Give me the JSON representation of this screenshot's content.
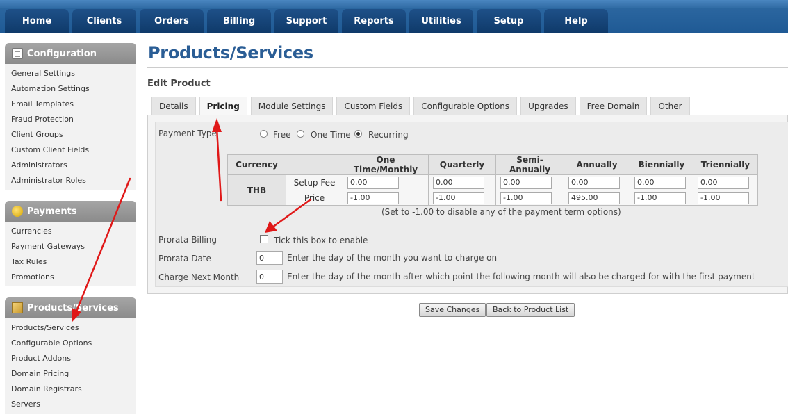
{
  "nav": {
    "tabs": [
      "Home",
      "Clients",
      "Orders",
      "Billing",
      "Support",
      "Reports",
      "Utilities",
      "Setup",
      "Help"
    ]
  },
  "sidebar": {
    "configuration": {
      "title": "Configuration",
      "items": [
        "General Settings",
        "Automation Settings",
        "Email Templates",
        "Fraud Protection",
        "Client Groups",
        "Custom Client Fields",
        "Administrators",
        "Administrator Roles"
      ]
    },
    "payments": {
      "title": "Payments",
      "items": [
        "Currencies",
        "Payment Gateways",
        "Tax Rules",
        "Promotions"
      ]
    },
    "products": {
      "title": "Products/Services",
      "items": [
        "Products/Services",
        "Configurable Options",
        "Product Addons",
        "Domain Pricing",
        "Domain Registrars",
        "Servers"
      ]
    }
  },
  "page": {
    "title": "Products/Services",
    "subtitle": "Edit Product"
  },
  "tabs": [
    "Details",
    "Pricing",
    "Module Settings",
    "Custom Fields",
    "Configurable Options",
    "Upgrades",
    "Free Domain",
    "Other"
  ],
  "active_tab": "Pricing",
  "payment_type": {
    "label": "Payment Type",
    "options": [
      "Free",
      "One Time",
      "Recurring"
    ],
    "selected": "Recurring"
  },
  "pricing_table": {
    "currency_header": "Currency",
    "currency": "THB",
    "columns": [
      "One Time/Monthly",
      "Quarterly",
      "Semi-Annually",
      "Annually",
      "Biennially",
      "Triennially"
    ],
    "rows": [
      {
        "label": "Setup Fee",
        "values": [
          "0.00",
          "0.00",
          "0.00",
          "0.00",
          "0.00",
          "0.00"
        ]
      },
      {
        "label": "Price",
        "values": [
          "-1.00",
          "-1.00",
          "-1.00",
          "495.00",
          "-1.00",
          "-1.00"
        ]
      }
    ],
    "note": "(Set to -1.00 to disable any of the payment term options)"
  },
  "prorata": {
    "billing_label": "Prorata Billing",
    "checkbox_text": "Tick this box to enable",
    "date_label": "Prorata Date",
    "date_value": "0",
    "date_help": "Enter the day of the month you want to charge on",
    "next_label": "Charge Next Month",
    "next_value": "0",
    "next_help": "Enter the day of the month after which point the following month will also be charged for with the first payment"
  },
  "buttons": {
    "save": "Save Changes",
    "back": "Back to Product List"
  },
  "colors": {
    "nav_tab": "#0f3a6a",
    "title": "#2a5d95",
    "arrow": "#e01818"
  }
}
